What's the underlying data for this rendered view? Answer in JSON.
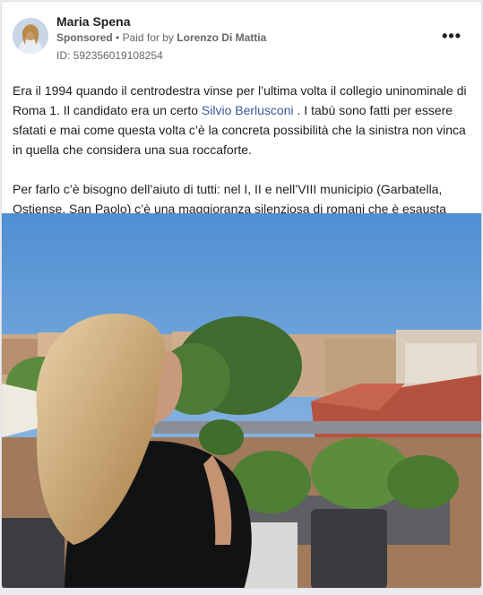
{
  "post": {
    "author": "Maria Spena",
    "sponsored_label": "Sponsored",
    "separator": "•",
    "paid_for_prefix": "Paid for by",
    "paid_for_by": "Lorenzo Di Mattia",
    "id_label": "ID: 592356019108254",
    "more_icon": "more-options-icon",
    "paragraph1_a": "Era il 1994 quando il centrodestra vinse per l’ultima volta il collegio uninominale di Roma 1. Il candidato era un certo ",
    "paragraph1_link": "Silvio Berlusconi",
    "paragraph1_b": " . I tabù sono fatti per essere sfatati e mai come questa volta c’è la concreta possibilità che la sinistra non vinca in quella che considera una sua roccaforte.",
    "paragraph2": "Per farlo c’è bisogno dell’aiuto di tutti: nel I, II e nell’VIII municipio (Garbatella, Ostiense, San Paolo) c’è una maggioranza silenziosa di romani che è esausta dell…"
  },
  "colors": {
    "link": "#385898",
    "sky": "#6fa2d8",
    "roof": "#b5523f"
  }
}
